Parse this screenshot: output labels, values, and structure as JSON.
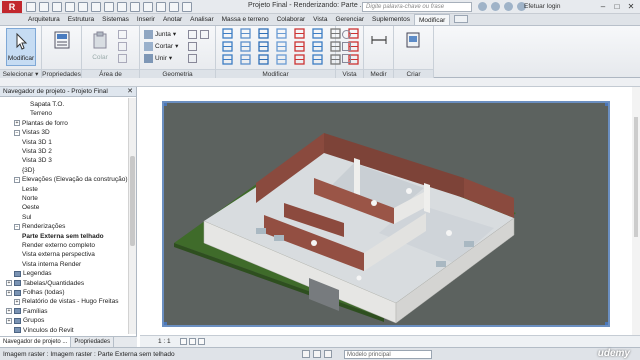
{
  "titlebar": {
    "app_logo": "R",
    "doc_title": "Projeto Final - Renderizando: Parte ...",
    "search_placeholder": "Digite palavra-chave ou frase",
    "user": "Efetuar login",
    "minimize": "–",
    "maximize": "□",
    "close": "✕"
  },
  "ribbon_tabs": [
    "Arquitetura",
    "Estrutura",
    "Sistemas",
    "Inserir",
    "Anotar",
    "Analisar",
    "Massa e terreno",
    "Colaborar",
    "Vista",
    "Gerenciar",
    "Suplementos",
    "Modificar"
  ],
  "active_tab_index": 11,
  "ribbon": {
    "modify_label": "Modificar",
    "selecionar": "Selecionar ▾",
    "propriedades": "Propriedades",
    "area_transferencia": "Área de transferência",
    "geometria": "Geometria",
    "modificar": "Modificar",
    "vista": "Vista",
    "medir": "Medir",
    "criar": "Criar",
    "juntar": "Junta",
    "cortar": "Cortar",
    "unir": "Unir",
    "colar_label": "Colar"
  },
  "browser": {
    "title": "Navegador de projeto - Projeto Final",
    "close": "✕",
    "tree": [
      {
        "label": "Sapata T.O.",
        "level": 3,
        "exp": ""
      },
      {
        "label": "Terreno",
        "level": 3,
        "exp": ""
      },
      {
        "label": "Plantas de forro",
        "level": 1,
        "exp": "+"
      },
      {
        "label": "Vistas 3D",
        "level": 1,
        "exp": "−"
      },
      {
        "label": "Vista 3D 1",
        "level": 2,
        "exp": ""
      },
      {
        "label": "Vista 3D 2",
        "level": 2,
        "exp": ""
      },
      {
        "label": "Vista 3D 3",
        "level": 2,
        "exp": ""
      },
      {
        "label": "{3D}",
        "level": 2,
        "exp": ""
      },
      {
        "label": "Elevações (Elevação da construção)",
        "level": 1,
        "exp": "−"
      },
      {
        "label": "Leste",
        "level": 2,
        "exp": ""
      },
      {
        "label": "Norte",
        "level": 2,
        "exp": ""
      },
      {
        "label": "Oeste",
        "level": 2,
        "exp": ""
      },
      {
        "label": "Sul",
        "level": 2,
        "exp": ""
      },
      {
        "label": "Renderizações",
        "level": 1,
        "exp": "−"
      },
      {
        "label": "Parte Externa sem telhado",
        "level": 2,
        "exp": "",
        "selected": true
      },
      {
        "label": "Render externo completo",
        "level": 2,
        "exp": ""
      },
      {
        "label": "Vista externa perspectiva",
        "level": 2,
        "exp": ""
      },
      {
        "label": "Vista interna Render",
        "level": 2,
        "exp": ""
      },
      {
        "label": "Legendas",
        "level": 0,
        "exp": ""
      },
      {
        "label": "Tabelas/Quantidades",
        "level": 0,
        "exp": "+"
      },
      {
        "label": "Folhas (todas)",
        "level": 0,
        "exp": "+"
      },
      {
        "label": "Relatório de vistas - Hugo Freitas",
        "level": 1,
        "exp": "+"
      },
      {
        "label": "Famílias",
        "level": 0,
        "exp": "+"
      },
      {
        "label": "Grupos",
        "level": 0,
        "exp": "+"
      },
      {
        "label": "Vínculos do Revit",
        "level": 0,
        "exp": ""
      }
    ],
    "tabs": [
      "Navegador de projeto ...",
      "Propriedades"
    ]
  },
  "view": {
    "scale": "1 : 1"
  },
  "status": {
    "text": "Imagem raster : Imagem raster : Parte Externa sem telhado",
    "model": "Modelo principal",
    "watermark": "udemy"
  },
  "colors": {
    "render_bg": "#5c625f",
    "grass": "#3f6b2a",
    "floor": "#d9dde0",
    "brick": "#8a4a3e",
    "wall_white": "#e8e8e6",
    "selection_blue": "#6b8fc1"
  }
}
